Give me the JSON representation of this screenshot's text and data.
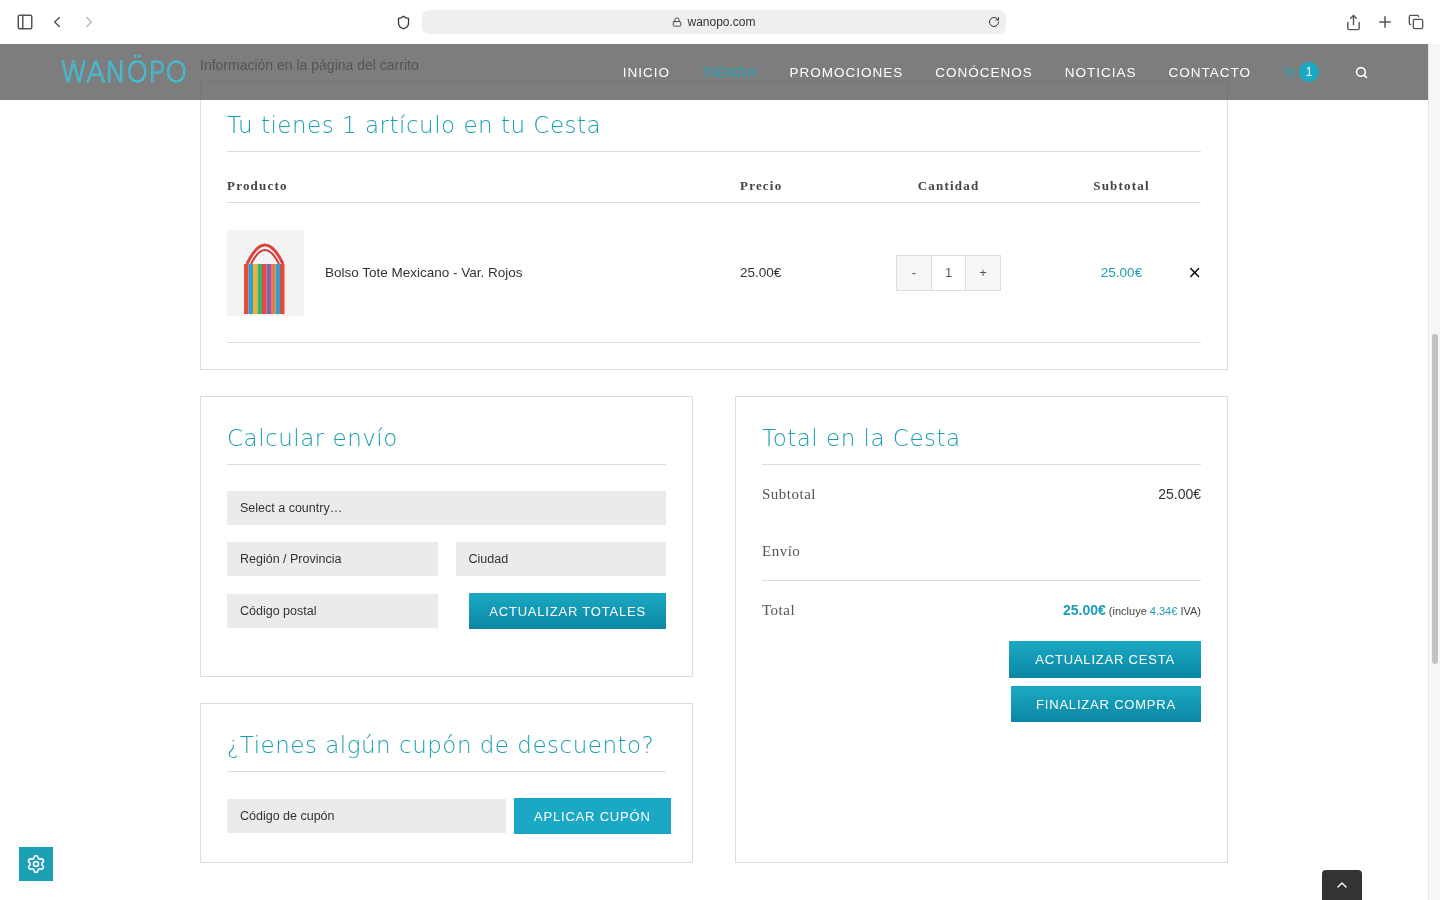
{
  "browser": {
    "url": "wanopo.com",
    "back_disabled": false,
    "forward_disabled": true
  },
  "header": {
    "logo": "WANÖPO",
    "nav": [
      {
        "label": "INICIO",
        "selected": false
      },
      {
        "label": "TIENDA",
        "selected": true
      },
      {
        "label": "PROMOCIONES",
        "selected": false
      },
      {
        "label": "CONÓCENOS",
        "selected": false
      },
      {
        "label": "NOTICIAS",
        "selected": false
      },
      {
        "label": "CONTACTO",
        "selected": false
      }
    ],
    "cart_count": "1"
  },
  "notice": "Información en la página del carrito",
  "cart": {
    "title": "Tu tienes 1 artículo en tu Cesta",
    "columns": [
      "Producto",
      "Precio",
      "Cantidad",
      "Subtotal"
    ],
    "items": [
      {
        "name": "Bolso Tote Mexicano - Var. Rojos",
        "price": "25.00€",
        "decrement": "-",
        "quantity": "1",
        "increment": "+",
        "subtotal": "25.00€",
        "remove": "×"
      }
    ]
  },
  "shipping": {
    "title": "Calcular envío",
    "country": "Select a country…",
    "region_placeholder": "Región / Provincia",
    "city_placeholder": "Ciudad",
    "postcode_placeholder": "Código postal",
    "button": "ACTUALIZAR TOTALES"
  },
  "coupon": {
    "title": "¿Tienes algún cupón de descuento?",
    "placeholder": "Código de cupón",
    "button": "APLICAR CUPÓN"
  },
  "totals": {
    "title": "Total en la Cesta",
    "subtotal_label": "Subtotal",
    "subtotal": "25.00€",
    "shipping_label": "Envío",
    "total_label": "Total",
    "total": "25.00€",
    "tax_prefix": "(incluye",
    "tax": "4.34€",
    "tax_suffix": "IVA)",
    "buttons": [
      "ACTUALIZAR CESTA",
      "FINALIZAR COMPRA"
    ]
  }
}
